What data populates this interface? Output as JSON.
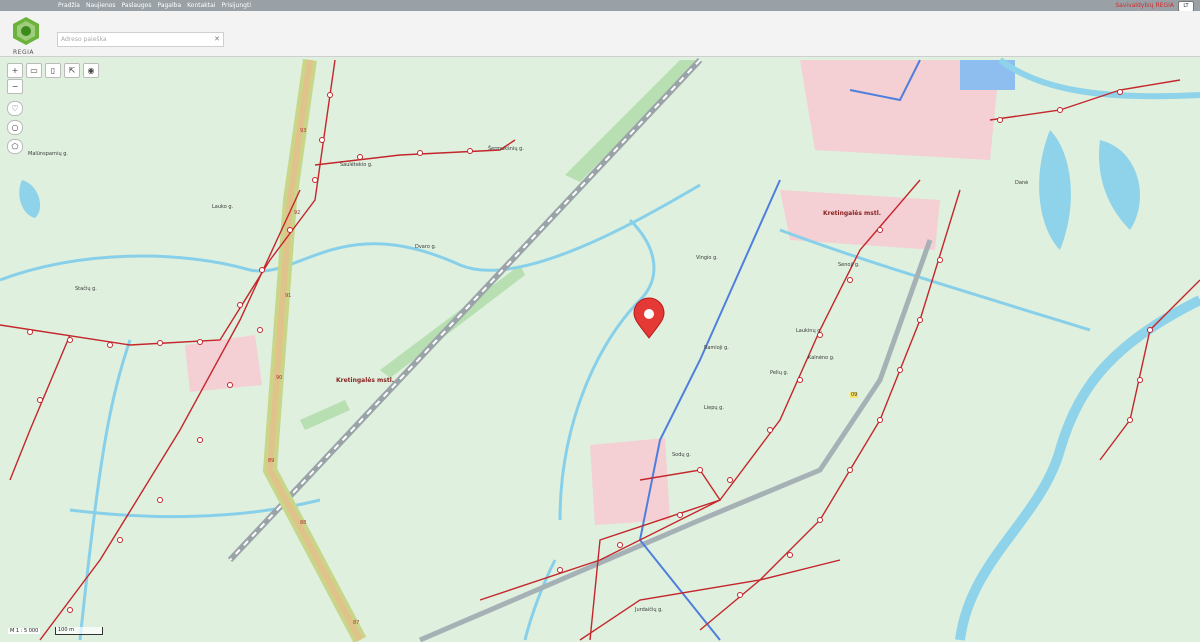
{
  "topbar": {
    "menu": [
      "Pradžia",
      "Naujienos",
      "Paslaugos",
      "Pagalba",
      "Kontaktai",
      "Prisijungti"
    ],
    "brand": "Savivaldybių REGIA",
    "lang": "LT"
  },
  "logo": {
    "text": "REGIA"
  },
  "search": {
    "placeholder": "Adreso paieška"
  },
  "map": {
    "scale_label": "M 1 : 5 000",
    "scale_bar": "100 m",
    "labels": {
      "town1": "Kretingalės mstl.",
      "town2": "Kretingalės mstl.",
      "street_sauleteku": "Šaulėtekio g.",
      "street_sermuksniu": "Šermukšnių g.",
      "street_dvaro": "Dvaro g.",
      "street_malunsparniu": "Malūnsparnių g.",
      "street_staciu": "Stačių g.",
      "street_vingio": "Vingio g.",
      "street_ramioji": "Ramioji g.",
      "street_liepu": "Liepų g.",
      "street_laukinu": "Laukinų g.",
      "street_peliu": "Pelių g.",
      "street_kalneno": "Kalnėno g.",
      "street_lauko": "Lauko g.",
      "street_senoji": "Senoji g.",
      "street_jurdaiciu": "Jurdaičių g.",
      "street_sodu": "Sodų g.",
      "river_dane": "Danė",
      "road_km": [
        "93",
        "92",
        "91",
        "90",
        "89",
        "88",
        "87"
      ],
      "road_no": "09"
    },
    "marker_color": "#e53935"
  }
}
